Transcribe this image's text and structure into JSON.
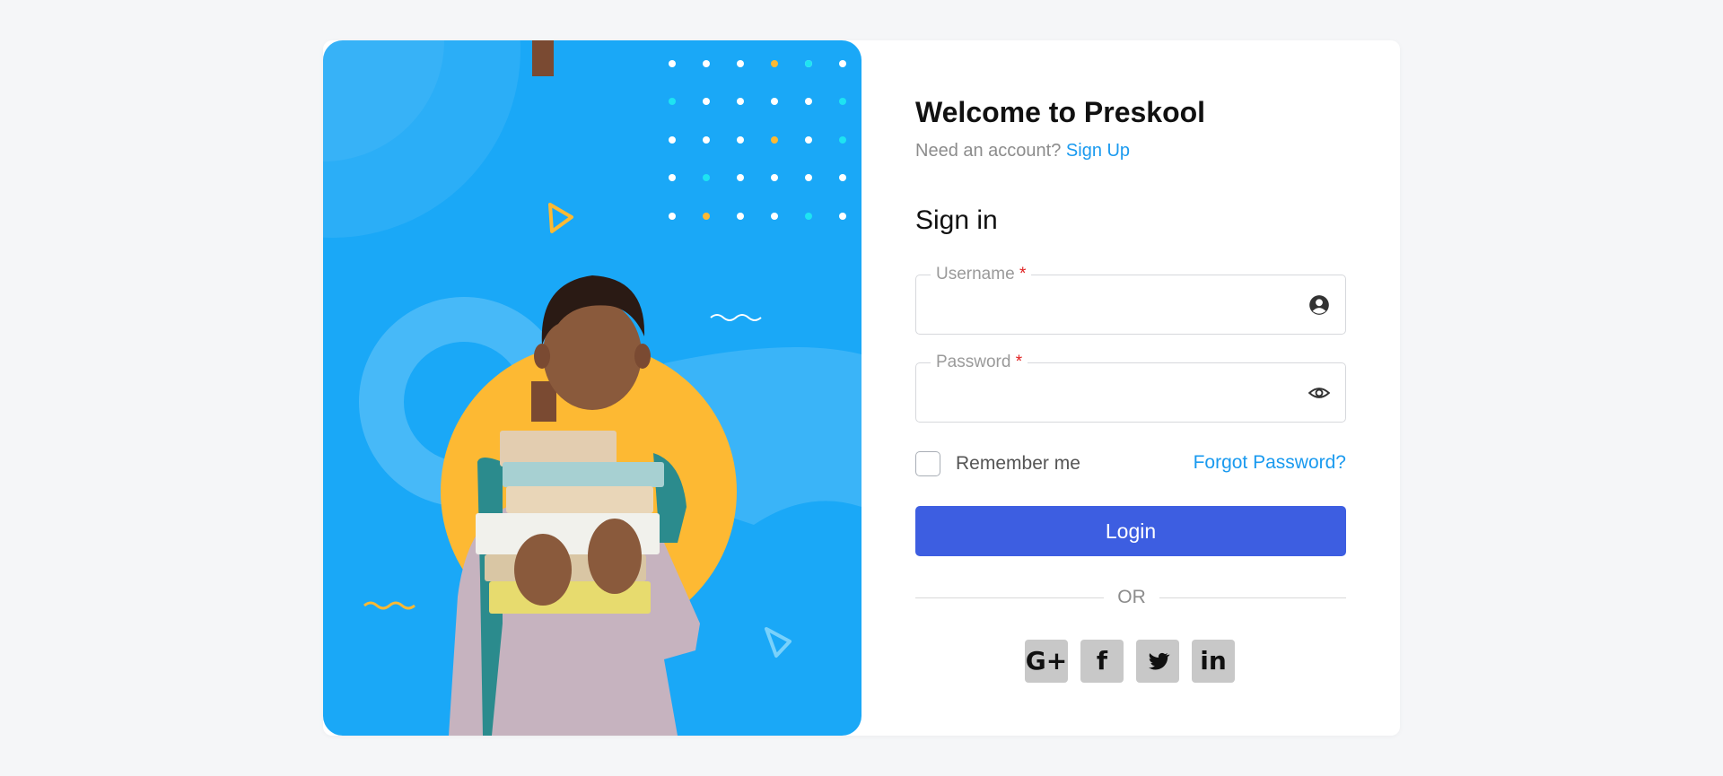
{
  "header": {
    "title": "Welcome to Preskool",
    "need_account": "Need an account?",
    "signup_link": "Sign Up"
  },
  "form": {
    "heading": "Sign in",
    "username_label": "Username",
    "password_label": "Password",
    "required_mark": "*",
    "username_value": "",
    "password_value": "",
    "remember_label": "Remember me",
    "remember_checked": false,
    "forgot_link": "Forgot Password?",
    "login_label": "Login",
    "or_text": "OR"
  },
  "icons": {
    "username": "user-circle-icon",
    "password": "eye-icon"
  },
  "social": [
    {
      "label": "G+",
      "icon": "google-plus-icon"
    },
    {
      "label": "f",
      "icon": "facebook-icon"
    },
    {
      "label": "🐦",
      "icon": "twitter-icon"
    },
    {
      "label": "in",
      "icon": "linkedin-icon"
    }
  ],
  "colors": {
    "hero_bg": "#1aa8f7",
    "accent_yellow": "#fdb933",
    "primary_button": "#3d5ee1",
    "link": "#1a9aef",
    "required": "#e02020"
  }
}
